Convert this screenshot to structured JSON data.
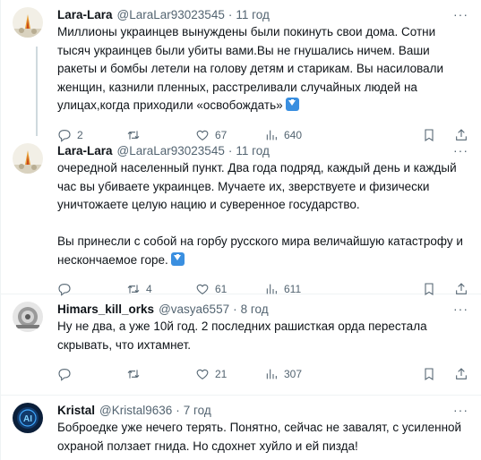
{
  "tweets": [
    {
      "name": "Lara-Lara",
      "handle": "@LaraLar93023545",
      "dot": "·",
      "time": "11 год",
      "more": "···",
      "text": "Миллионы украинцев вынуждены были покинуть свои дома. Сотни тысяч украинцев были убиты вами.Вы не гнушались ничем. Ваши ракеты и бомбы летели на голову детям и старикам. Вы насиловали женщин, казнили пленных, расстреливали случайных людей на улицах,когда приходили «освобождать»",
      "replies": "2",
      "retweets": "",
      "likes": "67",
      "views": "640"
    },
    {
      "name": "Lara-Lara",
      "handle": "@LaraLar93023545",
      "dot": "·",
      "time": "11 год",
      "more": "···",
      "text": "очередной населенный пункт. Два года подряд, каждый день и каждый час вы убиваете украинцев. Мучаете их, зверствуете и физически уничтожаете целую нацию и суверенное государство.\n\nВы принесли с собой на горбу русского мира величайшую катастрофу и нескончаемое горе.",
      "replies": "",
      "retweets": "4",
      "likes": "61",
      "views": "611"
    },
    {
      "name": "Himars_kill_orks",
      "handle": "@vasya6557",
      "dot": "·",
      "time": "8 год",
      "more": "···",
      "text": "Ну не два, а уже 10й год. 2 последних рашисткая орда перестала скрывать, что ихтамнет.",
      "replies": "",
      "retweets": "",
      "likes": "21",
      "views": "307"
    },
    {
      "name": "Kristal",
      "handle": "@Kristal9636",
      "dot": "·",
      "time": "7 год",
      "more": "···",
      "text": "Боброедке уже нечего терять. Понятно, сейчас не завалят, с усиленной охраной ползает гнида. Но сдохнет хуйло и ей пизда!",
      "avatar_text": "AI"
    }
  ],
  "colors": {
    "text": "#0f1419",
    "secondary": "#536471",
    "divider": "#eff3f4",
    "thread_line": "#cfd9de",
    "emoji_blue": "#3a8fe0"
  },
  "icons": [
    "reply-icon",
    "retweet-icon",
    "like-icon",
    "views-icon",
    "bookmark-icon",
    "share-icon",
    "arrow-down-emoji"
  ]
}
